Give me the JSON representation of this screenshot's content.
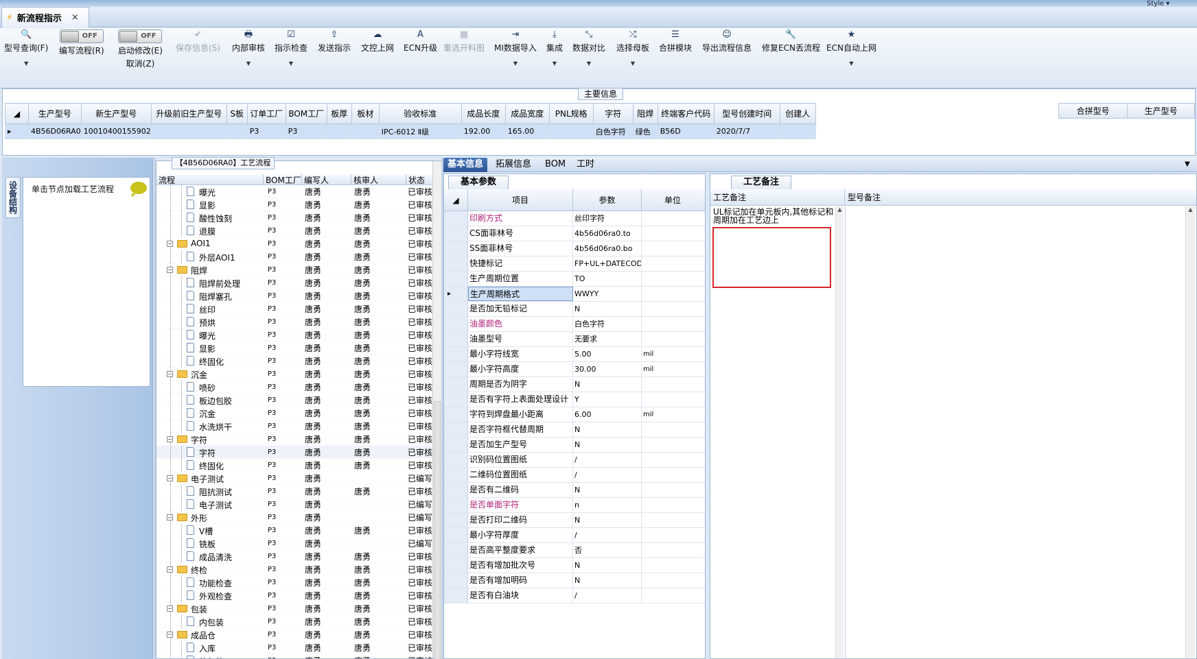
{
  "window": {
    "style_label": "Style ▾"
  },
  "doc_tab": {
    "title": "新流程指示",
    "close": "×"
  },
  "toolbar": {
    "buttons": [
      {
        "label": "型号查询(F)",
        "icon": "🔍"
      },
      {
        "label": "编写流程(R)",
        "toggle": "OFF"
      },
      {
        "label": "启动修改(E)",
        "sublabel": "取消(Z)",
        "toggle": "OFF"
      },
      {
        "label": "保存信息(S)",
        "icon": "✔"
      },
      {
        "label": "内部审核",
        "icon": "🖶"
      },
      {
        "label": "指示检查",
        "icon": "☑"
      },
      {
        "label": "发送指示",
        "icon": "⇪"
      },
      {
        "label": "文控上网",
        "icon": "☁"
      },
      {
        "label": "ECN升级",
        "icon": "A"
      },
      {
        "label": "重选开料图",
        "icon": "▦"
      },
      {
        "label": "MI数据导入",
        "icon": "⇥"
      },
      {
        "label": "集成",
        "icon": "⤓"
      },
      {
        "label": "数据对比",
        "icon": "⤡"
      },
      {
        "label": "选择母板",
        "icon": "⤮"
      },
      {
        "label": "合拼模块",
        "icon": "☰"
      },
      {
        "label": "导出流程信息",
        "icon": "☺"
      },
      {
        "label": "修复ECN丢流程",
        "icon": "🔧"
      },
      {
        "label": "ECN自动上网",
        "icon": "★"
      }
    ]
  },
  "main_info": {
    "title": "主要信息",
    "columns": [
      "生产型号",
      "新生产型号",
      "升级前旧生产型号",
      "S板",
      "订单工厂",
      "BOM工厂",
      "板厚",
      "板材",
      "验收标准",
      "成品长度",
      "成品宽度",
      "PNL规格",
      "字符",
      "阻焊",
      "终端客户代码",
      "型号创建时间",
      "创建人"
    ],
    "row": [
      "4B56D06RA0",
      "10010400155902",
      "",
      "",
      "P3",
      "P3",
      "",
      "",
      "IPC-6012 Ⅱ级",
      "192.00",
      "165.00",
      "",
      "白色字符",
      "绿色",
      "B56D",
      "2020/7/7",
      ""
    ],
    "merge_columns": [
      "合拼型号",
      "生产型号"
    ]
  },
  "left_panel": {
    "vtab": "设备结构",
    "hint": "单击节点加载工艺流程"
  },
  "tree": {
    "title": "【4B56D06RA0】工艺流程",
    "columns": [
      "流程",
      "BOM工厂",
      "编写人",
      "核审人",
      "状态"
    ],
    "rows": [
      {
        "name": "曝光",
        "lvl": 2,
        "bom": "P3",
        "writer": "唐勇",
        "reviewer": "唐勇",
        "status": "已审核"
      },
      {
        "name": "显影",
        "lvl": 2,
        "bom": "P3",
        "writer": "唐勇",
        "reviewer": "唐勇",
        "status": "已审核"
      },
      {
        "name": "酸性蚀刻",
        "lvl": 2,
        "bom": "P3",
        "writer": "唐勇",
        "reviewer": "唐勇",
        "status": "已审核"
      },
      {
        "name": "退膜",
        "lvl": 2,
        "bom": "P3",
        "writer": "唐勇",
        "reviewer": "唐勇",
        "status": "已审核"
      },
      {
        "name": "AOI1",
        "lvl": 1,
        "bom": "P3",
        "writer": "唐勇",
        "reviewer": "唐勇",
        "status": "已审核"
      },
      {
        "name": "外层AOI1",
        "lvl": 2,
        "bom": "P3",
        "writer": "唐勇",
        "reviewer": "唐勇",
        "status": "已审核"
      },
      {
        "name": "阻焊",
        "lvl": 1,
        "bom": "P3",
        "writer": "唐勇",
        "reviewer": "唐勇",
        "status": "已审核"
      },
      {
        "name": "阻焊前处理",
        "lvl": 2,
        "bom": "P3",
        "writer": "唐勇",
        "reviewer": "唐勇",
        "status": "已审核"
      },
      {
        "name": "阻焊塞孔",
        "lvl": 2,
        "bom": "P3",
        "writer": "唐勇",
        "reviewer": "唐勇",
        "status": "已审核"
      },
      {
        "name": "丝印",
        "lvl": 2,
        "bom": "P3",
        "writer": "唐勇",
        "reviewer": "唐勇",
        "status": "已审核"
      },
      {
        "name": "预烘",
        "lvl": 2,
        "bom": "P3",
        "writer": "唐勇",
        "reviewer": "唐勇",
        "status": "已审核"
      },
      {
        "name": "曝光",
        "lvl": 2,
        "bom": "P3",
        "writer": "唐勇",
        "reviewer": "唐勇",
        "status": "已审核"
      },
      {
        "name": "显影",
        "lvl": 2,
        "bom": "P3",
        "writer": "唐勇",
        "reviewer": "唐勇",
        "status": "已审核"
      },
      {
        "name": "终固化",
        "lvl": 2,
        "bom": "P3",
        "writer": "唐勇",
        "reviewer": "唐勇",
        "status": "已审核"
      },
      {
        "name": "沉金",
        "lvl": 1,
        "bom": "P3",
        "writer": "唐勇",
        "reviewer": "唐勇",
        "status": "已审核"
      },
      {
        "name": "喷砂",
        "lvl": 2,
        "bom": "P3",
        "writer": "唐勇",
        "reviewer": "唐勇",
        "status": "已审核"
      },
      {
        "name": "板边包胶",
        "lvl": 2,
        "bom": "P3",
        "writer": "唐勇",
        "reviewer": "唐勇",
        "status": "已审核"
      },
      {
        "name": "沉金",
        "lvl": 2,
        "bom": "P3",
        "writer": "唐勇",
        "reviewer": "唐勇",
        "status": "已审核"
      },
      {
        "name": "水洗烘干",
        "lvl": 2,
        "bom": "P3",
        "writer": "唐勇",
        "reviewer": "唐勇",
        "status": "已审核"
      },
      {
        "name": "字符",
        "lvl": 1,
        "bom": "P3",
        "writer": "唐勇",
        "reviewer": "唐勇",
        "status": "已审核"
      },
      {
        "name": "字符",
        "lvl": 2,
        "bom": "P3",
        "writer": "唐勇",
        "reviewer": "唐勇",
        "status": "已审核",
        "sel": true
      },
      {
        "name": "终固化",
        "lvl": 2,
        "bom": "P3",
        "writer": "唐勇",
        "reviewer": "唐勇",
        "status": "已审核"
      },
      {
        "name": "电子测试",
        "lvl": 1,
        "bom": "P3",
        "writer": "唐勇",
        "reviewer": "",
        "status": "已编写"
      },
      {
        "name": "阻抗测试",
        "lvl": 2,
        "bom": "P3",
        "writer": "唐勇",
        "reviewer": "唐勇",
        "status": "已审核"
      },
      {
        "name": "电子测试",
        "lvl": 2,
        "bom": "P3",
        "writer": "唐勇",
        "reviewer": "",
        "status": "已编写"
      },
      {
        "name": "外形",
        "lvl": 1,
        "bom": "P3",
        "writer": "唐勇",
        "reviewer": "",
        "status": "已编写"
      },
      {
        "name": "V槽",
        "lvl": 2,
        "bom": "P3",
        "writer": "唐勇",
        "reviewer": "唐勇",
        "status": "已审核"
      },
      {
        "name": "铣板",
        "lvl": 2,
        "bom": "P3",
        "writer": "唐勇",
        "reviewer": "",
        "status": "已编写"
      },
      {
        "name": "成品清洗",
        "lvl": 2,
        "bom": "P3",
        "writer": "唐勇",
        "reviewer": "唐勇",
        "status": "已审核"
      },
      {
        "name": "终检",
        "lvl": 1,
        "bom": "P3",
        "writer": "唐勇",
        "reviewer": "唐勇",
        "status": "已审核"
      },
      {
        "name": "功能检查",
        "lvl": 2,
        "bom": "P3",
        "writer": "唐勇",
        "reviewer": "唐勇",
        "status": "已审核"
      },
      {
        "name": "外观检查",
        "lvl": 2,
        "bom": "P3",
        "writer": "唐勇",
        "reviewer": "唐勇",
        "status": "已审核"
      },
      {
        "name": "包装",
        "lvl": 1,
        "bom": "P3",
        "writer": "唐勇",
        "reviewer": "唐勇",
        "status": "已审核"
      },
      {
        "name": "内包装",
        "lvl": 2,
        "bom": "P3",
        "writer": "唐勇",
        "reviewer": "唐勇",
        "status": "已审核"
      },
      {
        "name": "成品仓",
        "lvl": 1,
        "bom": "P3",
        "writer": "唐勇",
        "reviewer": "唐勇",
        "status": "已审核"
      },
      {
        "name": "入库",
        "lvl": 2,
        "bom": "P3",
        "writer": "唐勇",
        "reviewer": "唐勇",
        "status": "已审核"
      },
      {
        "name": "外包装",
        "lvl": 2,
        "bom": "P3",
        "writer": "唐勇",
        "reviewer": "唐勇",
        "status": "已审核"
      }
    ]
  },
  "right_tabs": [
    "基本信息",
    "拓展信息",
    "BOM",
    "工时"
  ],
  "params": {
    "tab": "基本参数",
    "columns": [
      "项目",
      "参数",
      "单位"
    ],
    "rows": [
      {
        "name": "印刷方式",
        "value": "丝印字符",
        "unit": "",
        "hl": true
      },
      {
        "name": "CS面菲林号",
        "value": "4b56d06ra0.to",
        "unit": ""
      },
      {
        "name": "SS面菲林号",
        "value": "4b56d06ra0.bo",
        "unit": ""
      },
      {
        "name": "快捷标记",
        "value": "FP+UL+DATECODE",
        "unit": ""
      },
      {
        "name": "生产周期位置",
        "value": "TO",
        "unit": ""
      },
      {
        "name": "生产周期格式",
        "value": "WWYY",
        "unit": "",
        "cur": true
      },
      {
        "name": "是否加无铅标记",
        "value": "N",
        "unit": ""
      },
      {
        "name": "油墨颜色",
        "value": "白色字符",
        "unit": "",
        "hl": true
      },
      {
        "name": "油墨型号",
        "value": "无要求",
        "unit": ""
      },
      {
        "name": "最小字符线宽",
        "value": "5.00",
        "unit": "mil"
      },
      {
        "name": "最小字符高度",
        "value": "30.00",
        "unit": "mil"
      },
      {
        "name": "周期是否为阴字",
        "value": "N",
        "unit": ""
      },
      {
        "name": "是否有字符上表面处理设计",
        "value": "Y",
        "unit": ""
      },
      {
        "name": "字符到焊盘最小距离",
        "value": "6.00",
        "unit": "mil"
      },
      {
        "name": "是否字符框代替周期",
        "value": "N",
        "unit": ""
      },
      {
        "name": "是否加生产型号",
        "value": "N",
        "unit": ""
      },
      {
        "name": "识别码位置图纸",
        "value": "/",
        "unit": ""
      },
      {
        "name": "二维码位置图纸",
        "value": "/",
        "unit": ""
      },
      {
        "name": "是否有二维码",
        "value": "N",
        "unit": ""
      },
      {
        "name": "是否单面字符",
        "value": "n",
        "unit": "",
        "hl": true
      },
      {
        "name": "是否打印二维码",
        "value": "N",
        "unit": ""
      },
      {
        "name": "最小字符厚度",
        "value": "/",
        "unit": ""
      },
      {
        "name": "是否高平整度要求",
        "value": "否",
        "unit": ""
      },
      {
        "name": "是否有增加批次号",
        "value": "N",
        "unit": ""
      },
      {
        "name": "是否有增加明码",
        "value": "N",
        "unit": ""
      },
      {
        "name": "是否有白油块",
        "value": "/",
        "unit": ""
      }
    ]
  },
  "notes": {
    "tab": "工艺备注",
    "col1": "工艺备注",
    "col2": "型号备注",
    "text": "UL标记加在单元板内,其他标记和周期加在工艺边上"
  }
}
